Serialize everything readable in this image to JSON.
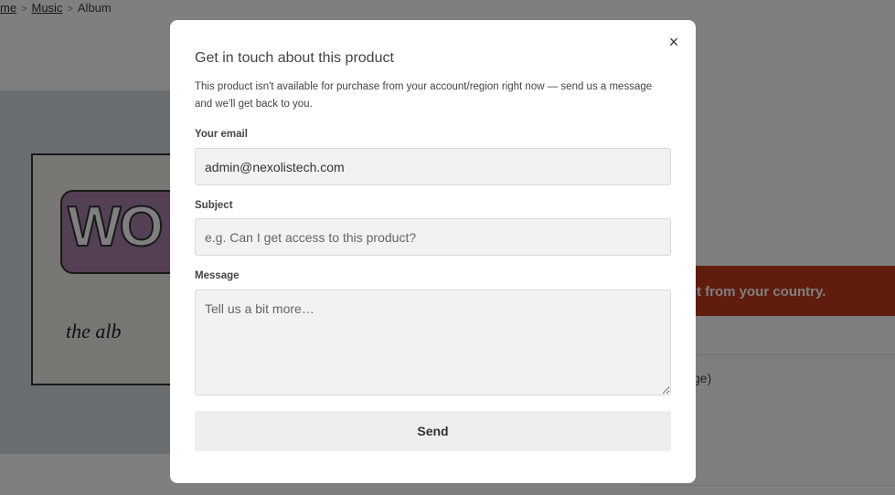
{
  "breadcrumb": {
    "items": [
      {
        "label": "me"
      },
      {
        "label": "Music"
      },
      {
        "label": "Album"
      }
    ]
  },
  "background": {
    "notice_text": "t from your country.",
    "partial_text": "ge)"
  },
  "album_art": {
    "logo_text": "WO",
    "script_text": "the   alb"
  },
  "modal": {
    "close_icon": "×",
    "title": "Get in touch about this product",
    "description": "This product isn't available for purchase from your account/region right now — send us a message and we'll get back to you.",
    "email": {
      "label": "Your email",
      "value": "admin@nexolistech.com"
    },
    "subject": {
      "label": "Subject",
      "placeholder": "e.g. Can I get access to this product?"
    },
    "message": {
      "label": "Message",
      "placeholder": "Tell us a bit more…"
    },
    "send_label": "Send"
  },
  "colors": {
    "notice_banner": "#c0391b",
    "overlay": "rgba(0,0,0,0.5)",
    "modal_bg": "#ffffff",
    "input_bg": "#f2f2f2",
    "button_bg": "#eeeeee"
  }
}
